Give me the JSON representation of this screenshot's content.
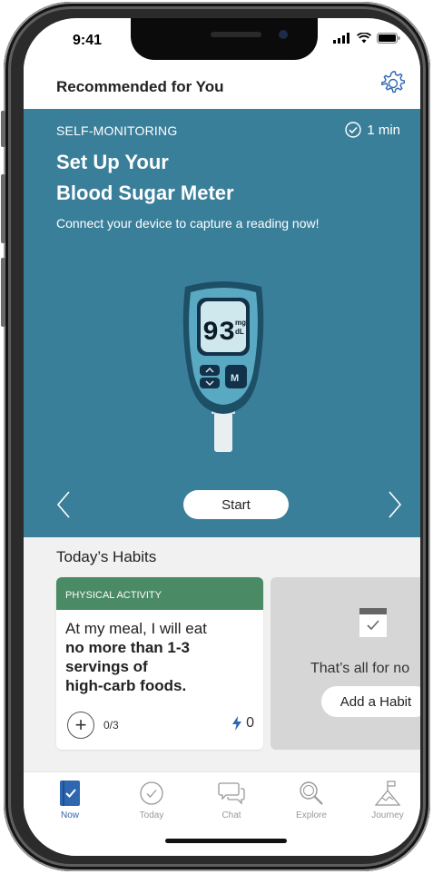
{
  "status_bar": {
    "time": "9:41"
  },
  "header": {
    "title": "Recommended for You",
    "settings_icon": "gear-icon"
  },
  "hero": {
    "category": "SELF-MONITORING",
    "duration": "1 min",
    "title_line1": "Set Up Your",
    "title_line2": "Blood Sugar Meter",
    "subtitle": "Connect your device to capture a reading now!",
    "meter": {
      "reading": "93",
      "unit_top": "mg",
      "unit_bottom": "dL",
      "button_label": "M"
    },
    "start_label": "Start",
    "background_color": "#3a7f9a"
  },
  "habits": {
    "title": "Today’s Habits",
    "card": {
      "category": "PHYSICAL ACTIVITY",
      "text_plain": "At my meal, I will eat",
      "text_bold_1": "no more than 1-3",
      "text_bold_2": "servings of",
      "text_bold_3": "high-carb foods.",
      "progress": "0/3",
      "streak": "0",
      "header_color": "#4a8a64"
    },
    "empty_card": {
      "message": "That’s all for no",
      "add_label": "Add a Habit"
    }
  },
  "tabs": [
    {
      "label": "Now",
      "icon": "now-icon",
      "active": true
    },
    {
      "label": "Today",
      "icon": "check-circle-icon",
      "active": false
    },
    {
      "label": "Chat",
      "icon": "chat-icon",
      "active": false
    },
    {
      "label": "Explore",
      "icon": "search-icon",
      "active": false
    },
    {
      "label": "Journey",
      "icon": "mountain-flag-icon",
      "active": false
    }
  ],
  "accent_color": "#2e66b0"
}
